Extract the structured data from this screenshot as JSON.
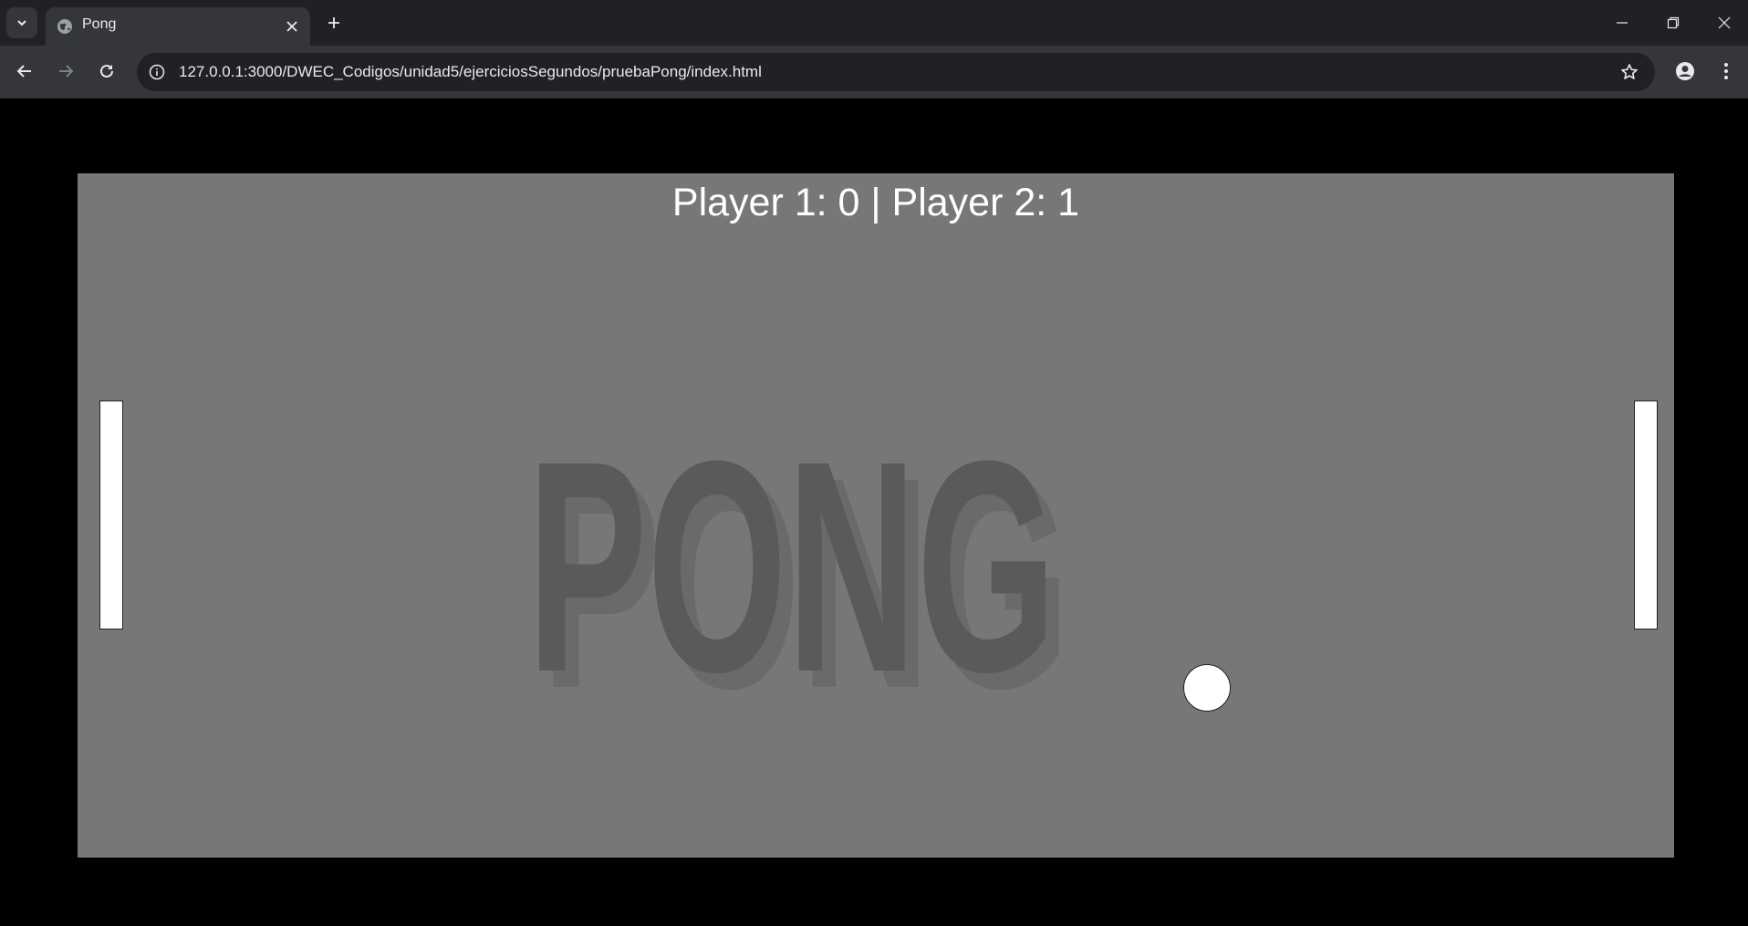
{
  "browser": {
    "tab": {
      "title": "Pong",
      "favicon": "globe-icon"
    },
    "address_bar": {
      "url": "127.0.0.1:3000/DWEC_Codigos/unidad5/ejerciciosSegundos/pruebaPong/index.html"
    },
    "icons": {
      "tab_search": "chevron-down-icon",
      "close_tab": "close-icon",
      "new_tab": "plus-icon",
      "minimize": "minimize-icon",
      "restore": "restore-icon",
      "close_window": "close-icon",
      "back": "back-arrow-icon",
      "forward": "forward-arrow-icon",
      "reload": "reload-icon",
      "site_info": "info-icon",
      "bookmark": "star-icon",
      "profile": "profile-icon",
      "menu": "kebab-menu-icon"
    }
  },
  "game": {
    "score_text": "Player 1: 0 | Player 2: 1",
    "logo_text": "PONG",
    "colors": {
      "canvas": "#777777",
      "logo": "#5a5a5a",
      "logo_shadow": "#6a6a6a",
      "paddles": "#ffffff",
      "ball": "#ffffff",
      "page_bg": "#000000"
    }
  }
}
